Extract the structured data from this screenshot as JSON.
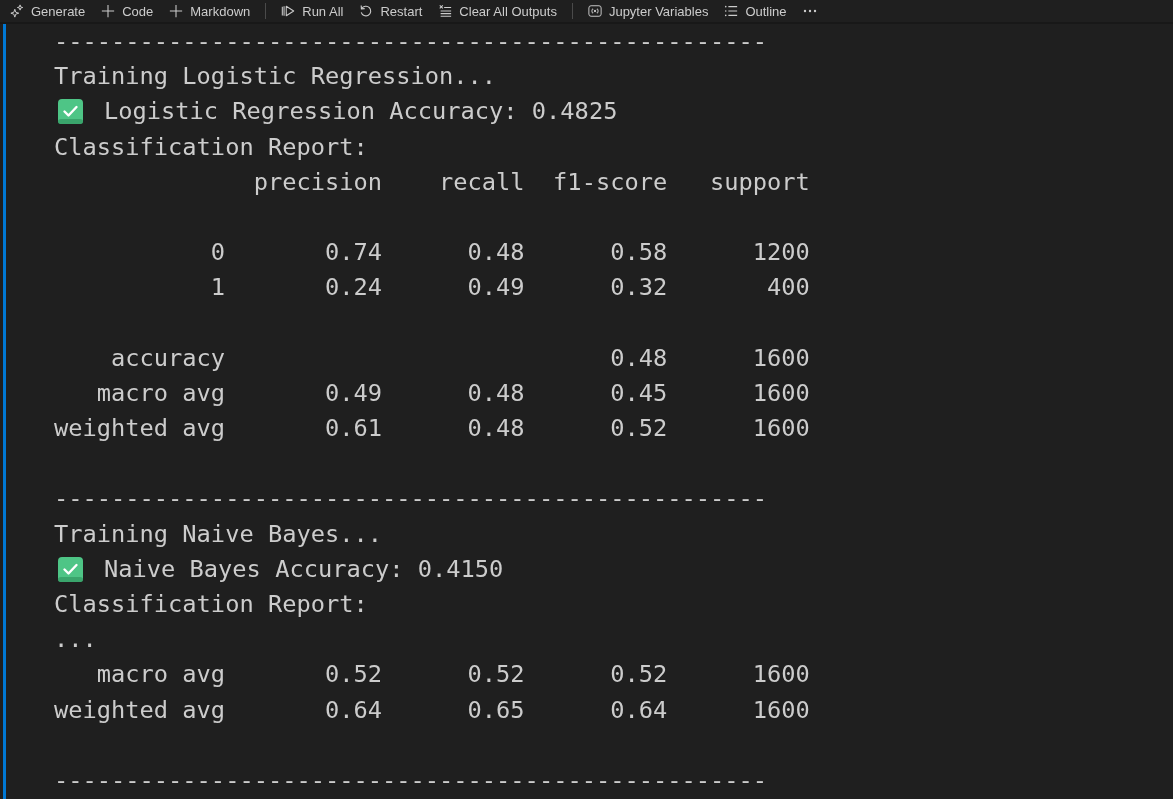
{
  "toolbar": [
    {
      "items": [
        {
          "kind": "generate",
          "label": "Generate"
        },
        {
          "kind": "add",
          "label": "Code"
        },
        {
          "kind": "add",
          "label": "Markdown"
        }
      ]
    },
    {
      "items": [
        {
          "kind": "run",
          "label": "Run All"
        },
        {
          "kind": "restart",
          "label": "Restart"
        },
        {
          "kind": "clear",
          "label": "Clear All Outputs"
        }
      ]
    },
    {
      "items": [
        {
          "kind": "variables",
          "label": "Jupyter Variables"
        },
        {
          "kind": "outline",
          "label": "Outline"
        },
        {
          "kind": "more"
        }
      ]
    }
  ],
  "output": {
    "lines": [
      {
        "kind": "divider",
        "text": "--------------------------------------------------"
      },
      {
        "kind": "text",
        "text": "Training Logistic Regression..."
      },
      {
        "kind": "success",
        "text": "Logistic Regression Accuracy: 0.4825"
      },
      {
        "kind": "text",
        "text": "Classification Report:"
      },
      {
        "kind": "table_header",
        "columns": [
          "precision",
          "recall",
          "f1-score",
          "support"
        ]
      },
      {
        "kind": "blank"
      },
      {
        "kind": "table_row",
        "label": "0",
        "precision": "0.74",
        "recall": "0.48",
        "f1_score": "0.58",
        "support": "1200"
      },
      {
        "kind": "table_row",
        "label": "1",
        "precision": "0.24",
        "recall": "0.49",
        "f1_score": "0.32",
        "support": "400"
      },
      {
        "kind": "blank"
      },
      {
        "kind": "table_row",
        "label": "accuracy",
        "f1_score": "0.48",
        "support": "1600"
      },
      {
        "kind": "table_row",
        "label": "macro avg",
        "precision": "0.49",
        "recall": "0.48",
        "f1_score": "0.45",
        "support": "1600"
      },
      {
        "kind": "table_row",
        "label": "weighted avg",
        "precision": "0.61",
        "recall": "0.48",
        "f1_score": "0.52",
        "support": "1600"
      },
      {
        "kind": "blank"
      },
      {
        "kind": "divider",
        "text": "--------------------------------------------------"
      },
      {
        "kind": "text",
        "text": "Training Naive Bayes..."
      },
      {
        "kind": "success",
        "text": "Naive Bayes Accuracy: 0.4150"
      },
      {
        "kind": "text",
        "text": "Classification Report:"
      },
      {
        "kind": "text",
        "text": "..."
      },
      {
        "kind": "table_row",
        "label": "macro avg",
        "precision": "0.52",
        "recall": "0.52",
        "f1_score": "0.52",
        "support": "1600"
      },
      {
        "kind": "table_row",
        "label": "weighted avg",
        "precision": "0.64",
        "recall": "0.65",
        "f1_score": "0.64",
        "support": "1600"
      },
      {
        "kind": "blank"
      },
      {
        "kind": "divider",
        "text": "--------------------------------------------------"
      }
    ]
  }
}
